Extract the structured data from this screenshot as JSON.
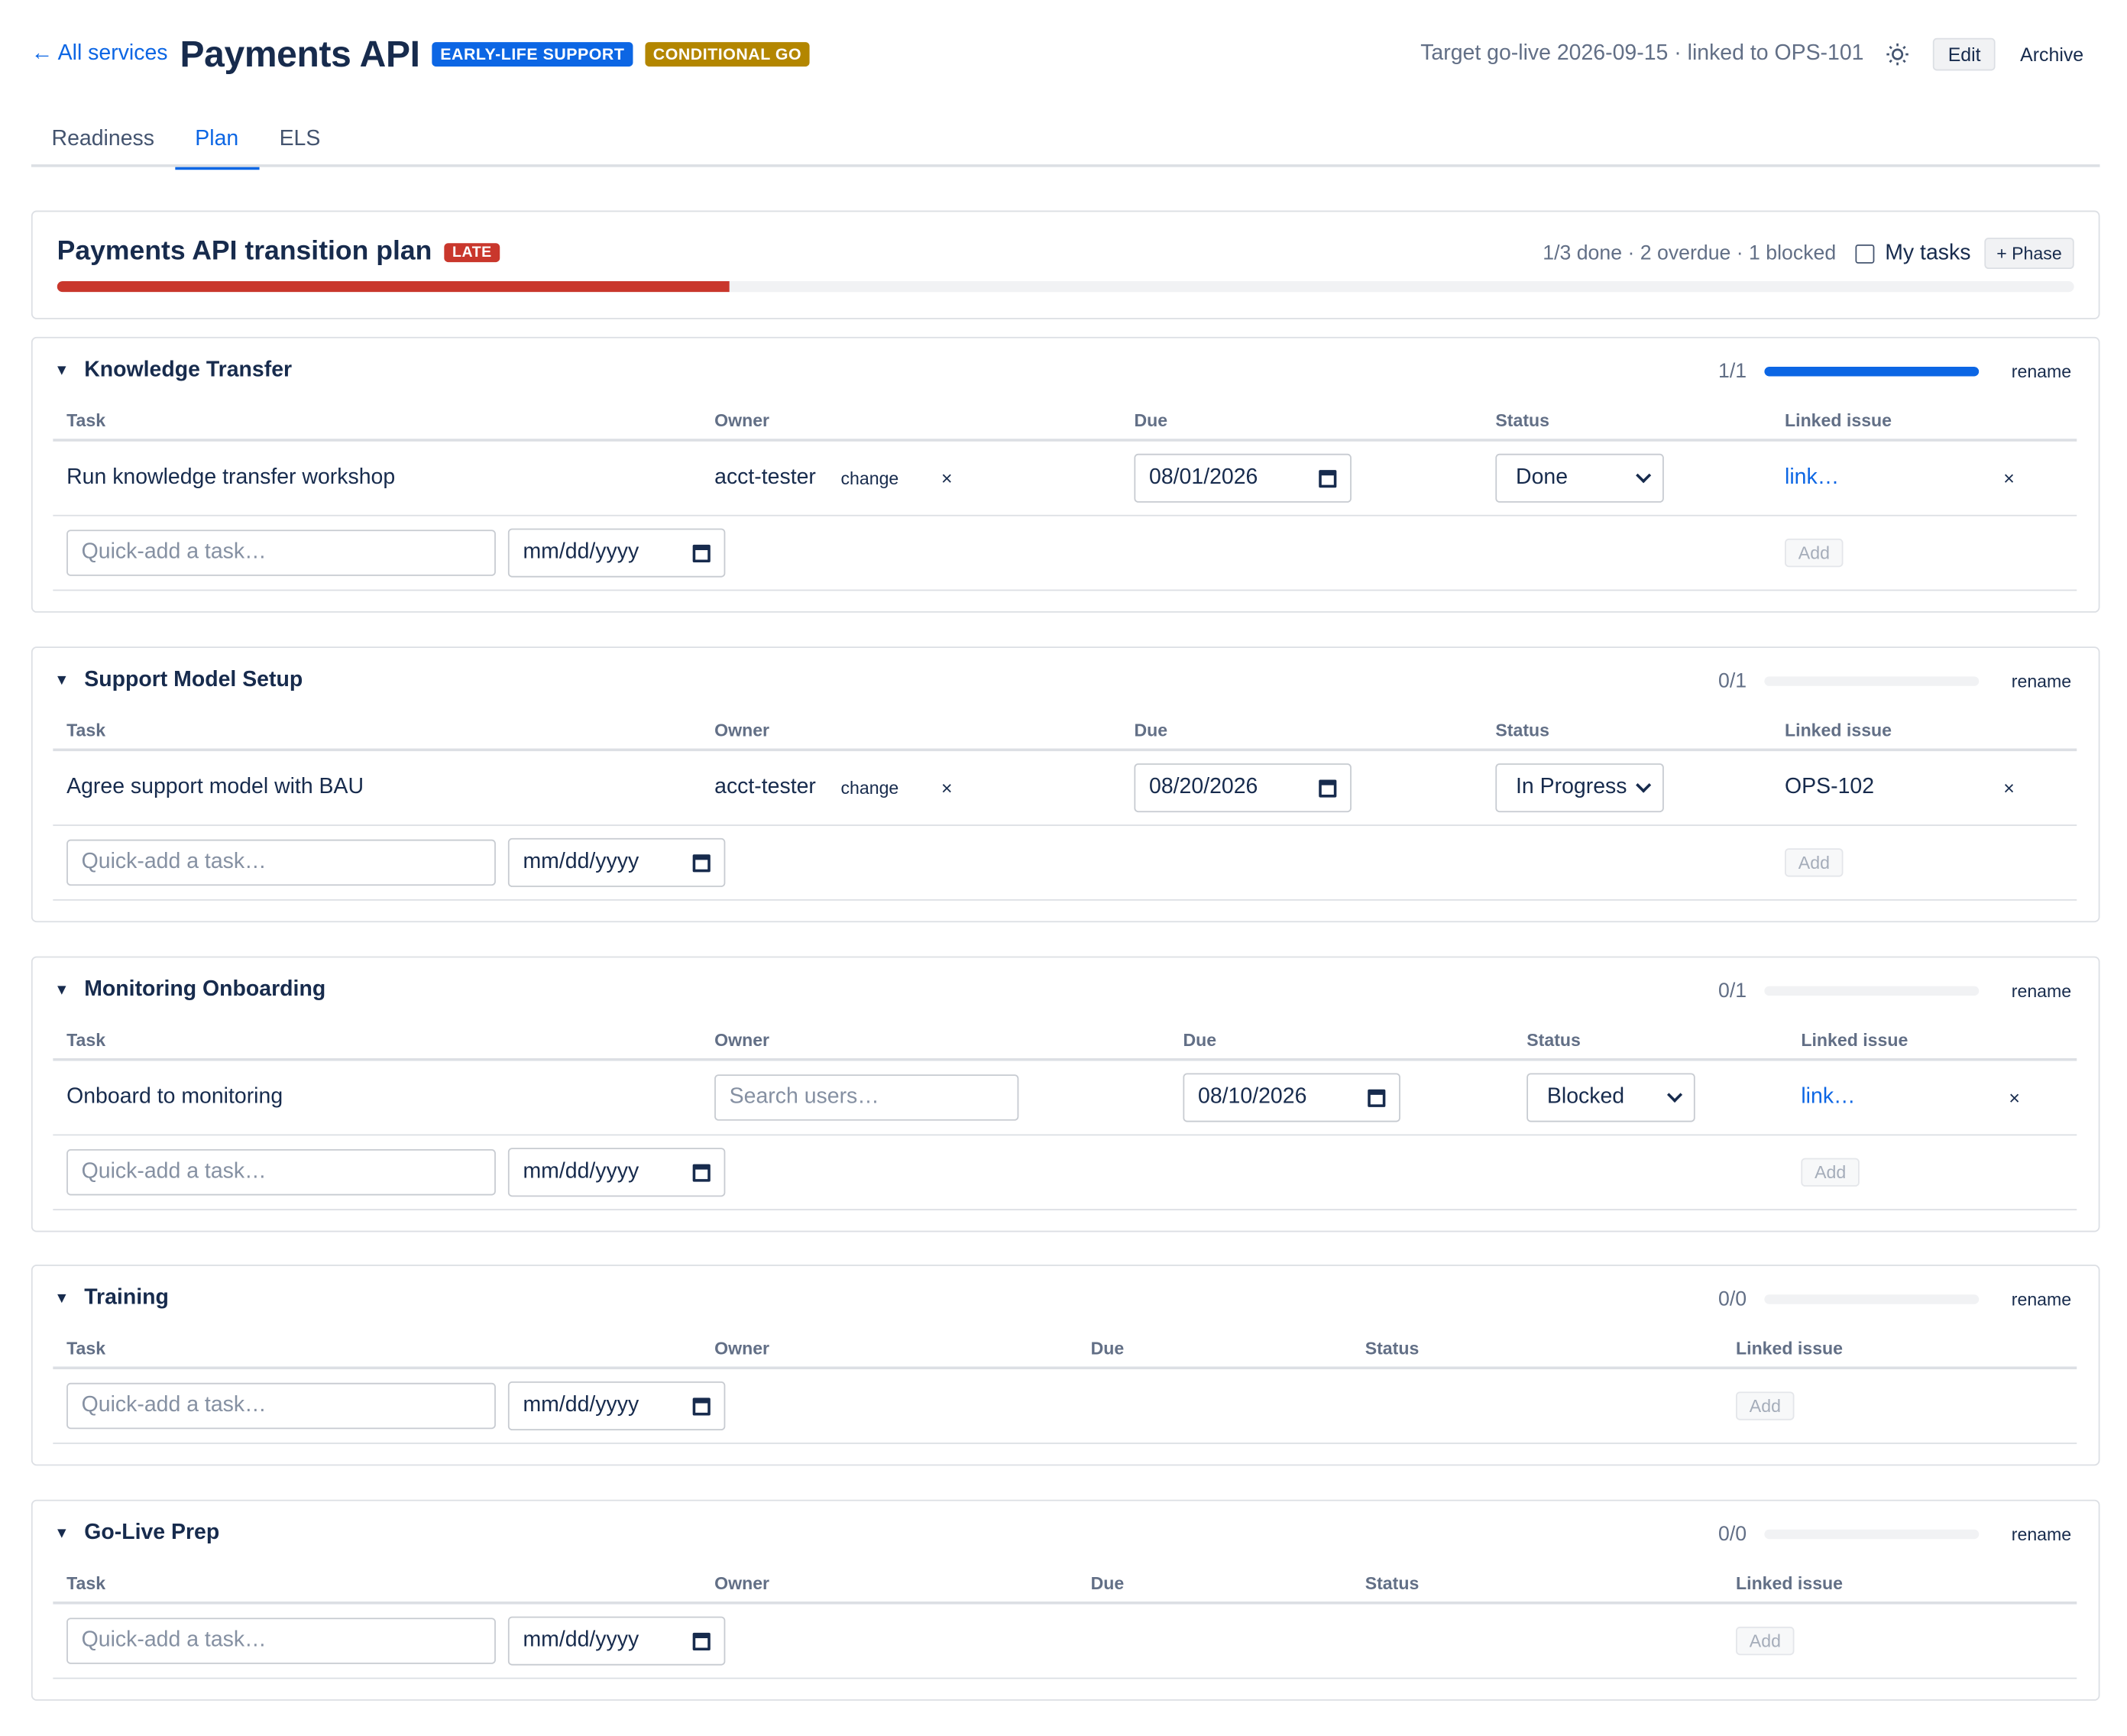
{
  "header": {
    "back_label": "← All services",
    "title": "Payments API",
    "badges": [
      "EARLY-LIFE SUPPORT",
      "CONDITIONAL GO"
    ],
    "meta": "Target go-live 2026-09-15 · linked to OPS-101",
    "edit_label": "Edit",
    "archive_label": "Archive"
  },
  "tabs": [
    "Readiness",
    "Plan",
    "ELS"
  ],
  "active_tab": "Plan",
  "plan": {
    "title": "Payments API transition plan",
    "status_badge": "LATE",
    "stats": "1/3 done · 2 overdue · 1 blocked",
    "my_tasks_label": "My tasks",
    "my_tasks_checked": false,
    "add_phase_label": "+ Phase",
    "progress_fraction": 0.333
  },
  "columns": {
    "task": "Task",
    "owner": "Owner",
    "due": "Due",
    "status": "Status",
    "linked": "Linked issue"
  },
  "phases": [
    {
      "name": "Knowledge Transfer",
      "count": "1/1",
      "progress_fraction": 1.0,
      "rename_label": "rename",
      "tasks": [
        {
          "name": "Run knowledge transfer workshop",
          "owner": "acct-tester",
          "change_label": "change",
          "remove_owner": "×",
          "due": "08/01/2026",
          "status": "Done",
          "linked": "link…",
          "delete": "×"
        }
      ],
      "quick_add_placeholder": "Quick-add a task…",
      "date_placeholder": "mm/dd/yyyy",
      "add_label": "Add"
    },
    {
      "name": "Support Model Setup",
      "count": "0/1",
      "progress_fraction": 0.0,
      "rename_label": "rename",
      "tasks": [
        {
          "name": "Agree support model with BAU",
          "owner": "acct-tester",
          "change_label": "change",
          "remove_owner": "×",
          "due": "08/20/2026",
          "status": "In Progress",
          "linked": "OPS-102",
          "delete": "×"
        }
      ],
      "quick_add_placeholder": "Quick-add a task…",
      "date_placeholder": "mm/dd/yyyy",
      "add_label": "Add"
    },
    {
      "name": "Monitoring Onboarding",
      "count": "0/1",
      "progress_fraction": 0.0,
      "rename_label": "rename",
      "tasks": [
        {
          "name": "Onboard to monitoring",
          "owner_placeholder": "Search users…",
          "due": "08/10/2026",
          "status": "Blocked",
          "linked": "link…",
          "delete": "×"
        }
      ],
      "quick_add_placeholder": "Quick-add a task…",
      "date_placeholder": "mm/dd/yyyy",
      "add_label": "Add"
    },
    {
      "name": "Training",
      "count": "0/0",
      "progress_fraction": 0.0,
      "rename_label": "rename",
      "tasks": [],
      "quick_add_placeholder": "Quick-add a task…",
      "date_placeholder": "mm/dd/yyyy",
      "add_label": "Add"
    },
    {
      "name": "Go-Live Prep",
      "count": "0/0",
      "progress_fraction": 0.0,
      "rename_label": "rename",
      "tasks": [],
      "quick_add_placeholder": "Quick-add a task…",
      "date_placeholder": "mm/dd/yyyy",
      "add_label": "Add"
    }
  ],
  "colors": {
    "accent": "#0c66e4",
    "late": "#c9372c",
    "conditional": "#b38600",
    "text": "#172b4d"
  }
}
